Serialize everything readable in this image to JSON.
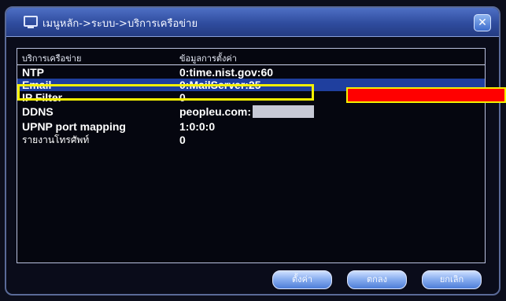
{
  "window": {
    "title": "เมนูหลัก->ระบบ->บริการเครือข่าย"
  },
  "table": {
    "headers": {
      "name": "บริการเครือข่าย",
      "value": "ข้อมูลการตั้งค่า"
    },
    "rows": [
      {
        "name": "NTP",
        "value": "0:time.nist.gov:60"
      },
      {
        "name": "Email",
        "value": "0:MailServer:25"
      },
      {
        "name": "IP Filter",
        "value": "0"
      },
      {
        "name": "DDNS",
        "value": "peopleu.com:"
      },
      {
        "name": "UPNP port mapping",
        "value": "1:0:0:0"
      },
      {
        "name": "รายงานโทรศัพท์",
        "value": "0"
      }
    ]
  },
  "buttons": {
    "setup": "ตั้งค่า",
    "ok": "ตกลง",
    "cancel": "ยกเลิก"
  },
  "colors": {
    "selection": "#1f3f9e",
    "annotation_box": "#f5f000",
    "annotation_arrow": "#ff0000"
  },
  "icons": {
    "title": "monitor-icon",
    "close": "close-icon"
  }
}
